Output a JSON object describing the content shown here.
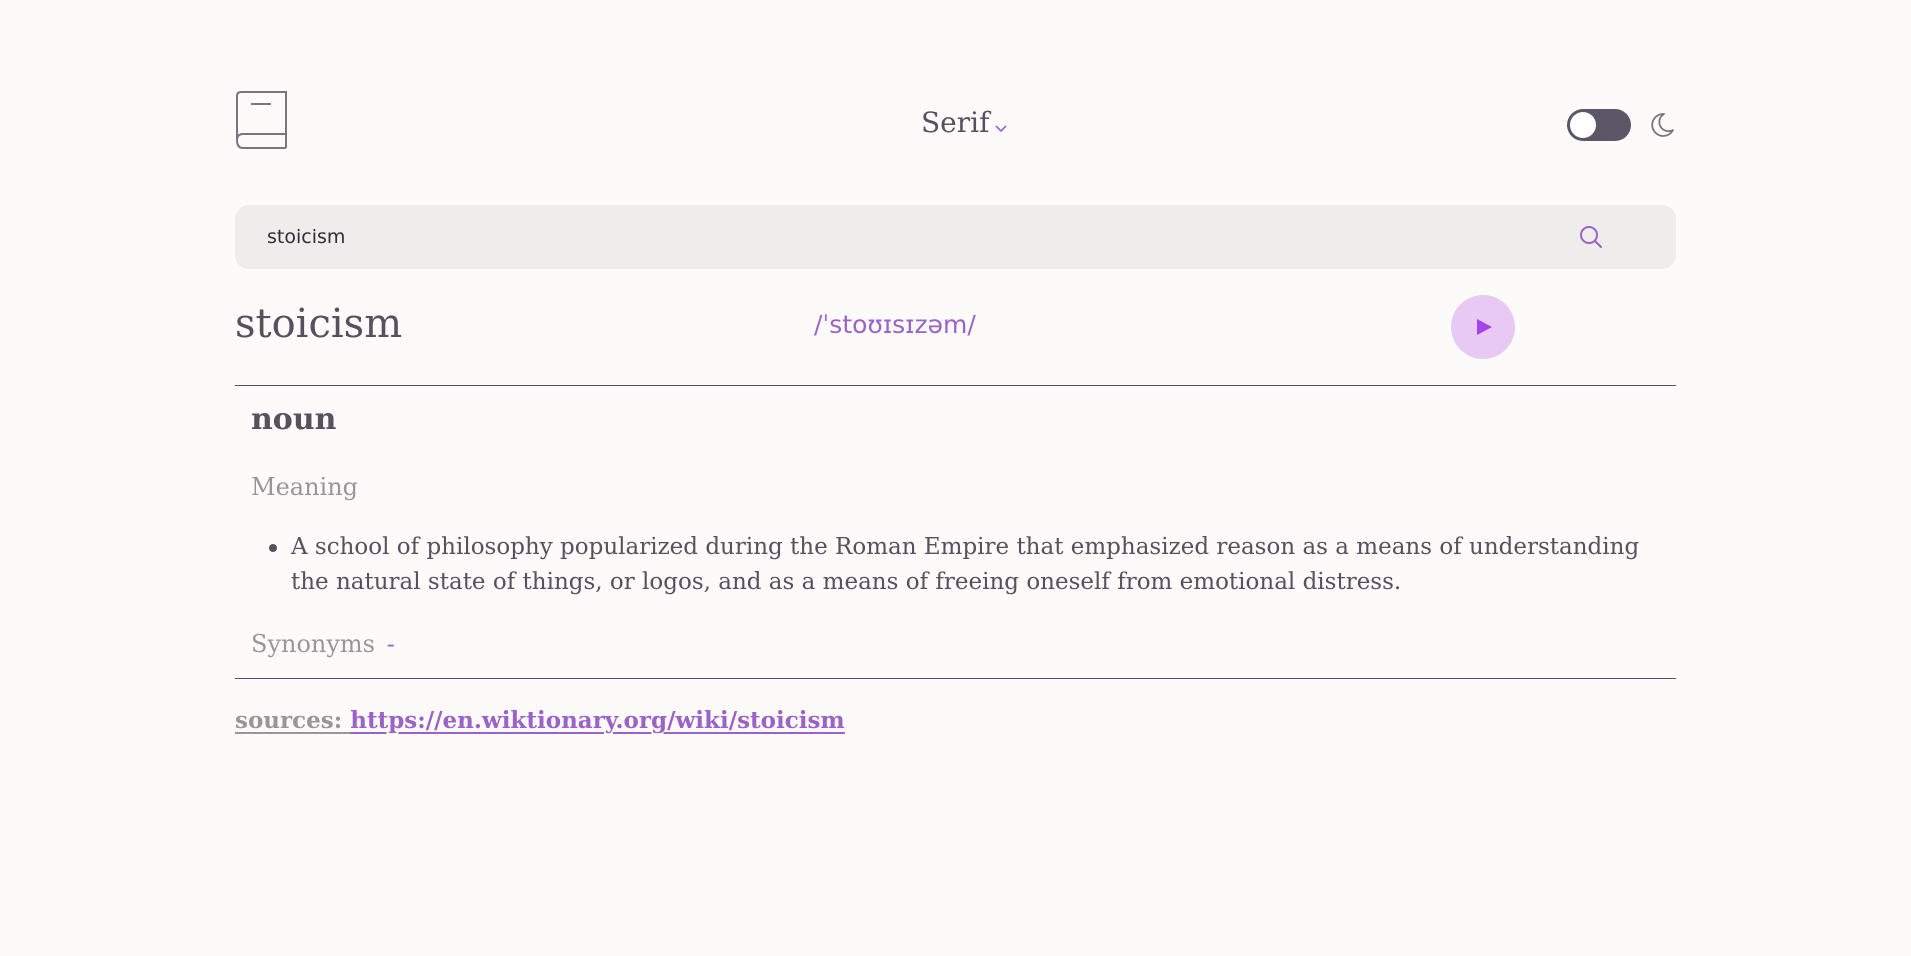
{
  "header": {
    "logo_icon": "book-icon",
    "font_selector": {
      "label": "Serif",
      "icon": "chevron-down-icon"
    },
    "theme_toggle": {
      "state": "light",
      "icon": "moon-icon"
    }
  },
  "search": {
    "value": "stoicism",
    "icon": "search-icon"
  },
  "entry": {
    "word": "stoicism",
    "phonetic": "/ˈstoʊɪsɪzəm/",
    "play_icon": "play-icon",
    "meanings": [
      {
        "part_of_speech": "noun",
        "meaning_label": "Meaning",
        "definitions": [
          "A school of philosophy popularized during the Roman Empire that emphasized reason as a means of understanding the natural state of things, or logos, and as a means of freeing oneself from emotional distress."
        ],
        "synonyms_label": "Synonyms",
        "synonyms_value": "-"
      }
    ]
  },
  "sources": {
    "label": "sources:",
    "url": "https://en.wiktionary.org/wiki/stoicism"
  },
  "colors": {
    "accent": "#9b62c9",
    "text": "#56505f",
    "muted": "#9a9598",
    "background": "#fcfbfa",
    "search_bg": "#eeedec",
    "play_bg": "#e8c9f4"
  }
}
